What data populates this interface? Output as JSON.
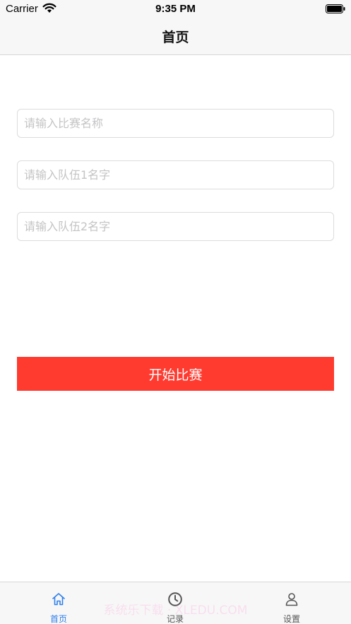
{
  "status_bar": {
    "carrier": "Carrier",
    "time": "9:35 PM"
  },
  "nav": {
    "title": "首页"
  },
  "form": {
    "match_name_placeholder": "请输入比赛名称",
    "team1_placeholder": "请输入队伍1名字",
    "team2_placeholder": "请输入队伍2名字",
    "match_name_value": "",
    "team1_value": "",
    "team2_value": ""
  },
  "start_button": {
    "label": "开始比赛",
    "color": "#ff3b30"
  },
  "watermark": {
    "text": "系统乐下载 · XLEDU.COM"
  },
  "tab_bar": {
    "active_color": "#2f80ed",
    "tabs": [
      {
        "label": "首页",
        "icon": "home-icon",
        "active": true
      },
      {
        "label": "记录",
        "icon": "clock-icon",
        "active": false
      },
      {
        "label": "设置",
        "icon": "person-icon",
        "active": false
      }
    ]
  }
}
